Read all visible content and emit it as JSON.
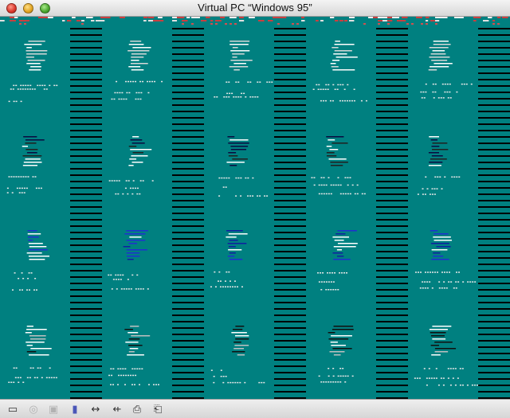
{
  "window": {
    "title": "Virtual PC “Windows 95”",
    "controls": [
      "close",
      "minimize",
      "zoom"
    ]
  },
  "guest_screen": {
    "background_color": "#008080",
    "state": "corrupted display with repeated garbled column pattern"
  },
  "status_bar": {
    "icons": [
      {
        "name": "hard-drive-icon",
        "glyph": "▭",
        "enabled": true
      },
      {
        "name": "cd-rom-icon",
        "glyph": "◎",
        "enabled": false
      },
      {
        "name": "floppy-icon",
        "glyph": "▣",
        "enabled": false
      },
      {
        "name": "shared-folder-icon",
        "glyph": "▮",
        "enabled": true
      },
      {
        "name": "network-icon",
        "glyph": "↔",
        "enabled": true
      },
      {
        "name": "usb-icon",
        "glyph": "⇷",
        "enabled": true
      },
      {
        "name": "printer-icon",
        "glyph": "⎙",
        "enabled": true
      },
      {
        "name": "keyboard-capture-icon",
        "glyph": "⎗",
        "enabled": true
      }
    ]
  }
}
